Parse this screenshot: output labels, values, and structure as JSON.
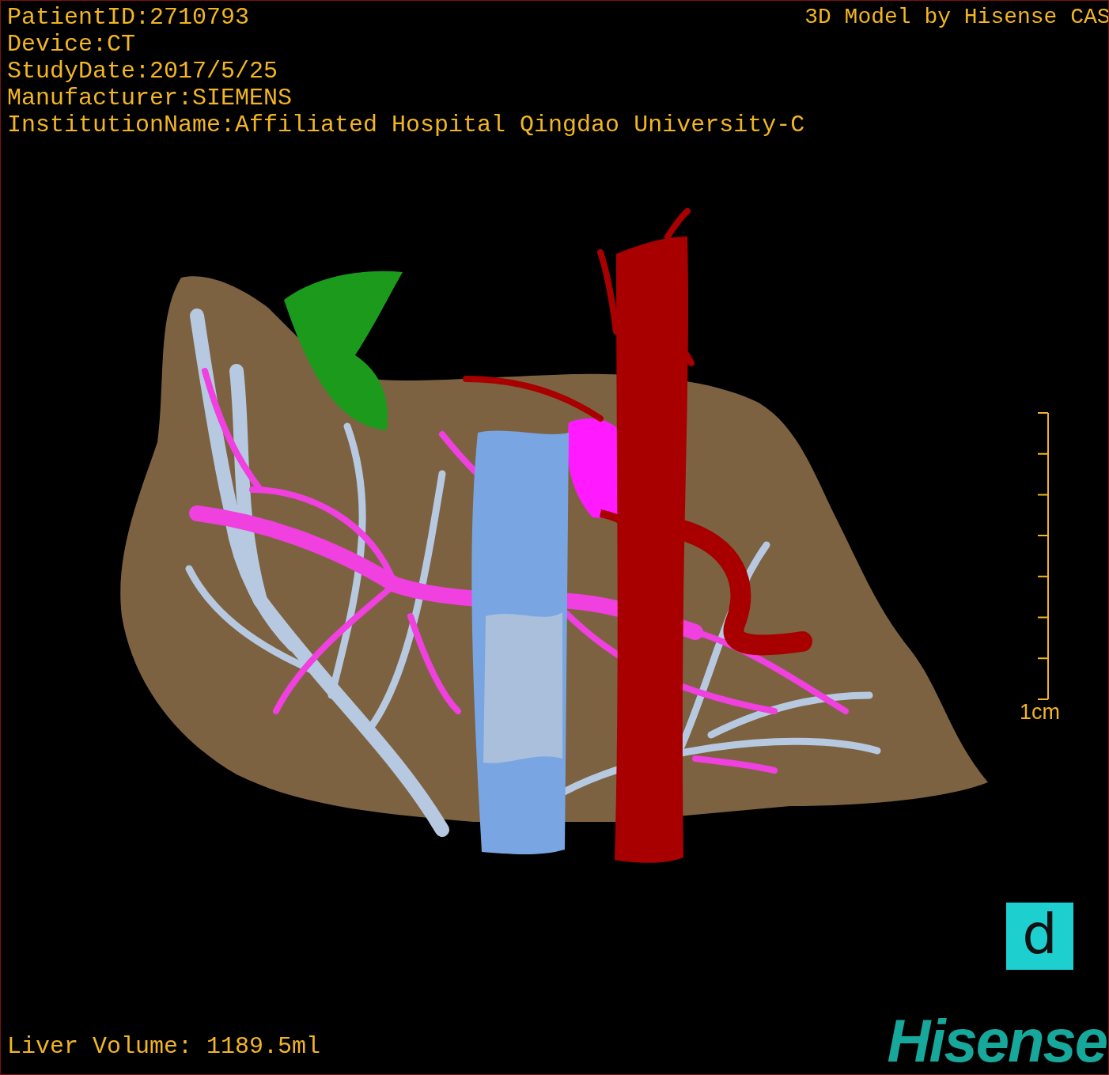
{
  "info_lines": [
    "PatientID:2710793",
    "Device:CT",
    "StudyDate:2017/5/25",
    "Manufacturer:SIEMENS",
    "InstitutionName:Affiliated Hospital Qingdao University-C"
  ],
  "credit": "3D Model by Hisense CAS",
  "scale_bar": {
    "label": "1cm"
  },
  "view_badge": "d",
  "liver_volume": "Liver Volume: 1189.5ml",
  "logo": "Hisense"
}
